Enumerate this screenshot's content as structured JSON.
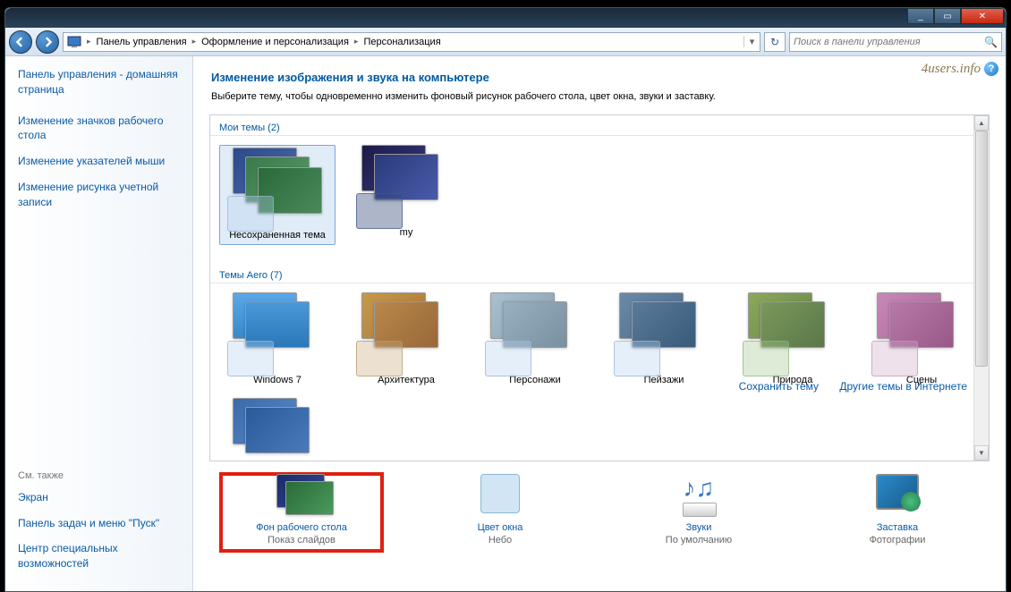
{
  "window": {
    "min": "_",
    "max": "▭",
    "close": "✕"
  },
  "breadcrumb": {
    "root_icon": "🖥",
    "seg1": "Панель управления",
    "seg2": "Оформление и персонализация",
    "seg3": "Персонализация"
  },
  "search": {
    "placeholder": "Поиск в панели управления"
  },
  "sidebar": {
    "home": "Панель управления - домашняя страница",
    "links": {
      "l0": "Изменение значков рабочего стола",
      "l1": "Изменение указателей мыши",
      "l2": "Изменение рисунка учетной записи"
    },
    "see_also": "См. также",
    "footer": {
      "f0": "Экран",
      "f1": "Панель задач и меню \"Пуск\"",
      "f2": "Центр специальных возможностей"
    }
  },
  "page": {
    "title": "Изменение изображения и звука на компьютере",
    "subtitle": "Выберите тему, чтобы одновременно изменить фоновый рисунок рабочего стола, цвет окна, звуки и заставку."
  },
  "groups": {
    "my": "Мои темы (2)",
    "aero": "Темы Aero (7)"
  },
  "themes": {
    "my0": "Несохраненная тема",
    "my1": "my",
    "a0": "Windows 7",
    "a1": "Архитектура",
    "a2": "Персонажи",
    "a3": "Пейзажи",
    "a4": "Природа",
    "a5": "Сцены"
  },
  "actions": {
    "save": "Сохранить тему",
    "more": "Другие темы в Интернете"
  },
  "footer_items": {
    "bg": {
      "link": "Фон рабочего стола",
      "val": "Показ слайдов"
    },
    "color": {
      "link": "Цвет окна",
      "val": "Небо"
    },
    "sound": {
      "link": "Звуки",
      "val": "По умолчанию"
    },
    "saver": {
      "link": "Заставка",
      "val": "Фотографии"
    }
  },
  "watermark": "4users.info",
  "help": "?"
}
